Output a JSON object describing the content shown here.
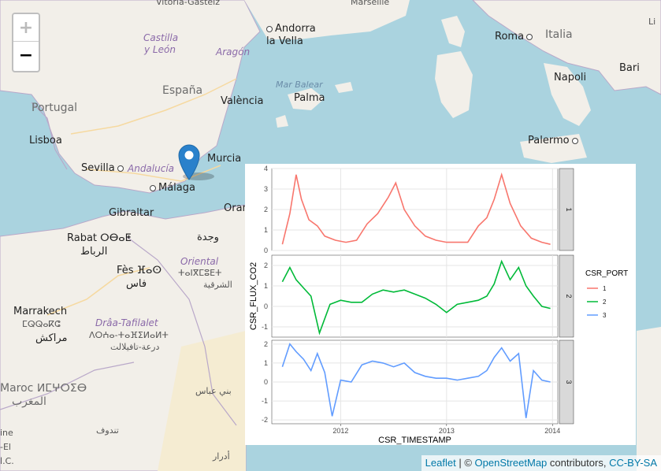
{
  "map": {
    "labels": {
      "top_left": "Vitoria-Gasteiz",
      "top_right": "Marseille",
      "andorra_1": "Andorra",
      "andorra_2": "la Vella",
      "castilla_1": "Castilla",
      "castilla_2": "y León",
      "aragon": "Aragón",
      "espana": "España",
      "portugal": "Portugal",
      "lisboa": "Lisboa",
      "valencia": "València",
      "mar_balear": "Mar Balear",
      "palma": "Palma",
      "sevilla": "Sevilla",
      "andalucia": "Andalucía",
      "malaga": "Málaga",
      "murcia": "Murcia",
      "gibraltar": "Gibraltar",
      "oran": "Oran",
      "rabat": "Rabat ⵔⴱⴰⵟ",
      "rabat_ar": "الرباط",
      "wajda": "وجدة",
      "oriental": "Oriental",
      "oriental_tz": "ⵜⴰⵏⴳⵎⵓⴹⵜ",
      "oriental_ar": "الشرقية",
      "fes": "Fès ⴼⴰⵙ",
      "fes_ar": "فاس",
      "marrakech": "Marrakech",
      "marrakech_tz": "ⵎⵕⵕⴰⴽⵛ",
      "marrakech_ar": "مراكش",
      "draa": "Drâa-Tafilalet",
      "draa_tz": "ⴷⵔⵄⴰ-ⵜⴰⴼⵉⵍⴰⵍⵜ",
      "draa_ar": "درعة-تافيلالت",
      "maroc": "Maroc ⵍⵎⵖⵔⵉⴱ",
      "maroc_ar": "المغرب",
      "bni_abbas": "بني عباس",
      "tindouf": "تندوف",
      "adrar": "أدرار",
      "roma": "Roma",
      "italia": "Italia",
      "napoli": "Napoli",
      "bari": "Bari",
      "palermo": "Palermo",
      "ajaccio_edge": "Li",
      "ine": "ine",
      "el": "-El",
      "aco": "ا.C."
    },
    "icons": {
      "marker": "map-pin-icon"
    }
  },
  "zoom": {
    "zoom_in_label": "+",
    "zoom_out_label": "−"
  },
  "attribution": {
    "leaflet": "Leaflet",
    "sep1": " | © ",
    "osm": "OpenStreetMap",
    "contrib": " contributors, ",
    "license": "CC-BY-SA"
  },
  "chart_data": {
    "type": "line",
    "xlabel": "CSR_TIMESTAMP",
    "ylabel": "CSR_FLUX_CO2",
    "x_ticks": [
      "2012",
      "2013",
      "2014"
    ],
    "legend": {
      "title": "CSR_PORT",
      "placement": "right",
      "entries": [
        "1",
        "2",
        "3"
      ]
    },
    "grid": true,
    "facets": [
      {
        "strip": "1",
        "color": "#F8766D",
        "ylim": [
          0,
          4
        ],
        "yticks": [
          "0",
          "1",
          "2",
          "3",
          "4"
        ],
        "x": [
          2011.45,
          2011.52,
          2011.58,
          2011.63,
          2011.7,
          2011.78,
          2011.85,
          2011.95,
          2012.05,
          2012.15,
          2012.25,
          2012.35,
          2012.45,
          2012.52,
          2012.6,
          2012.7,
          2012.8,
          2012.9,
          2013.0,
          2013.1,
          2013.2,
          2013.3,
          2013.38,
          2013.45,
          2013.52,
          2013.6,
          2013.7,
          2013.8,
          2013.9,
          2013.98
        ],
        "y": [
          0.3,
          1.8,
          3.7,
          2.5,
          1.5,
          1.2,
          0.7,
          0.5,
          0.4,
          0.5,
          1.3,
          1.8,
          2.6,
          3.3,
          2.0,
          1.2,
          0.7,
          0.5,
          0.4,
          0.4,
          0.4,
          1.2,
          1.6,
          2.5,
          3.7,
          2.3,
          1.2,
          0.6,
          0.4,
          0.3
        ]
      },
      {
        "strip": "2",
        "color": "#00BA38",
        "ylim": [
          -1.5,
          2.5
        ],
        "yticks": [
          "-1",
          "0",
          "1",
          "2"
        ],
        "x": [
          2011.45,
          2011.52,
          2011.58,
          2011.65,
          2011.72,
          2011.8,
          2011.9,
          2012.0,
          2012.1,
          2012.2,
          2012.3,
          2012.4,
          2012.5,
          2012.6,
          2012.7,
          2012.8,
          2012.9,
          2013.0,
          2013.1,
          2013.2,
          2013.3,
          2013.38,
          2013.45,
          2013.52,
          2013.6,
          2013.68,
          2013.75,
          2013.82,
          2013.9,
          2013.98
        ],
        "y": [
          1.2,
          1.9,
          1.3,
          0.9,
          0.5,
          -1.3,
          0.1,
          0.3,
          0.2,
          0.2,
          0.6,
          0.8,
          0.7,
          0.8,
          0.6,
          0.4,
          0.1,
          -0.3,
          0.1,
          0.2,
          0.3,
          0.5,
          1.1,
          2.2,
          1.3,
          1.9,
          1.0,
          0.5,
          0.0,
          -0.1
        ]
      },
      {
        "strip": "3",
        "color": "#619CFF",
        "ylim": [
          -2.2,
          2.2
        ],
        "yticks": [
          "-2",
          "-1",
          "0",
          "1",
          "2"
        ],
        "x": [
          2011.45,
          2011.52,
          2011.58,
          2011.65,
          2011.72,
          2011.78,
          2011.85,
          2011.92,
          2012.0,
          2012.1,
          2012.2,
          2012.3,
          2012.4,
          2012.5,
          2012.6,
          2012.7,
          2012.8,
          2012.9,
          2013.0,
          2013.1,
          2013.2,
          2013.3,
          2013.38,
          2013.45,
          2013.52,
          2013.6,
          2013.68,
          2013.75,
          2013.82,
          2013.9,
          2013.98
        ],
        "y": [
          0.8,
          2.0,
          1.6,
          1.2,
          0.6,
          1.5,
          0.5,
          -1.8,
          0.1,
          0.0,
          0.9,
          1.1,
          1.0,
          0.8,
          1.0,
          0.5,
          0.3,
          0.2,
          0.2,
          0.1,
          0.2,
          0.3,
          0.6,
          1.3,
          1.8,
          1.1,
          1.5,
          -1.9,
          0.6,
          0.1,
          0.0
        ]
      }
    ]
  }
}
